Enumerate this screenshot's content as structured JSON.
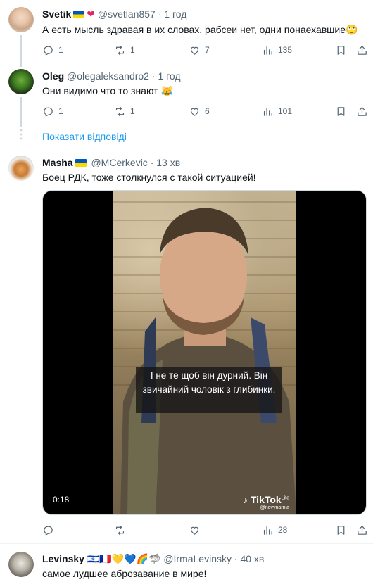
{
  "posts": [
    {
      "name": "Svetik",
      "handle": "@svetlan857",
      "time": "1 год",
      "text": "А есть мысль здравая в их словах, рабсеи нет, одни понаехавшие🙄",
      "replies": "1",
      "reposts": "1",
      "likes": "7",
      "views": "135"
    },
    {
      "name": "Oleg",
      "handle": "@olegaleksandro2",
      "time": "1 год",
      "text": "Они видимо что то знают 😹",
      "replies": "1",
      "reposts": "1",
      "likes": "6",
      "views": "101"
    },
    {
      "name": "Masha",
      "handle": "@MCerkevic",
      "time": "13 хв",
      "text": "Боец РДК, тоже столкнулся с такой ситуацией!",
      "replies": "",
      "reposts": "",
      "likes": "",
      "views": "28"
    },
    {
      "name": "Levinsky",
      "name_emojis": "🇮🇱🇫🇷💛💙🌈🦈",
      "handle": "@IrmaLevinsky",
      "time": "40 хв",
      "text": "самое лудшее аброзавание в мире!"
    }
  ],
  "show_replies": "Показати відповіді",
  "video": {
    "caption": "І не те щоб він дурний. Він звичайний чоловік з глибинки.",
    "duration": "0:18",
    "brand": "TikTok",
    "brand_sub": "Lite",
    "watermark": "@novynarnia"
  },
  "meta_separator": "·",
  "icons": [
    "reply-icon",
    "repost-icon",
    "like-icon",
    "views-icon",
    "bookmark-icon",
    "share-icon"
  ],
  "colors": {
    "link": "#1d9bf0",
    "muted": "#536471",
    "border": "#eff3f4"
  }
}
